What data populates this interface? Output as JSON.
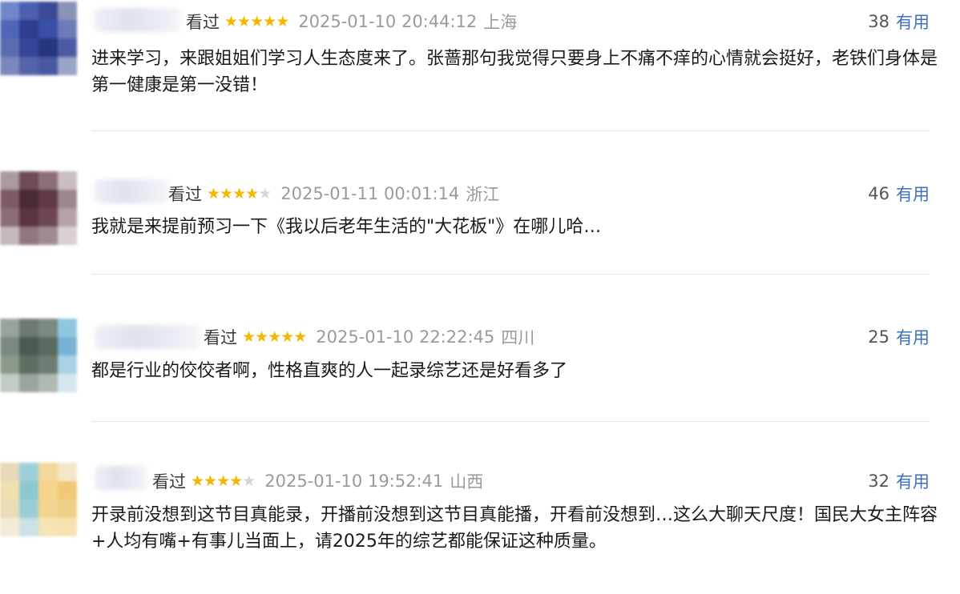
{
  "comments": [
    {
      "watched": "看过",
      "rating": 5,
      "datetime": "2025-01-10 20:44:12",
      "location": "上海",
      "useful_count": "38",
      "useful_label": "有用",
      "text": "进来学习，来跟姐姐们学习人生态度来了。张蔷那句我觉得只要身上不痛不痒的心情就会挺好，老铁们身体是第一健康是第一没错！"
    },
    {
      "watched": "看过",
      "rating": 4,
      "datetime": "2025-01-11 00:01:14",
      "location": "浙江",
      "useful_count": "46",
      "useful_label": "有用",
      "text": "我就是来提前预习一下《我以后老年生活的\"大花板\"》在哪儿哈…"
    },
    {
      "watched": "看过",
      "rating": 5,
      "datetime": "2025-01-10 22:22:45",
      "location": "四川",
      "useful_count": "25",
      "useful_label": "有用",
      "text": "都是行业的佼佼者啊，性格直爽的人一起录综艺还是好看多了"
    },
    {
      "watched": "看过",
      "rating": 4,
      "datetime": "2025-01-10 19:52:41",
      "location": "山西",
      "useful_count": "32",
      "useful_label": "有用",
      "text": "开录前没想到这节目真能录，开播前没想到这节目真能播，开看前没想到…这么大聊天尺度！国民大女主阵容+人均有嘴+有事儿当面上，请2025年的综艺都能保证这种质量。"
    }
  ],
  "colors": {
    "star": "#f7b500",
    "star_empty": "#d6d6d6",
    "useful_link": "#3c6fbf",
    "meta_gray": "#9a9a9a"
  }
}
